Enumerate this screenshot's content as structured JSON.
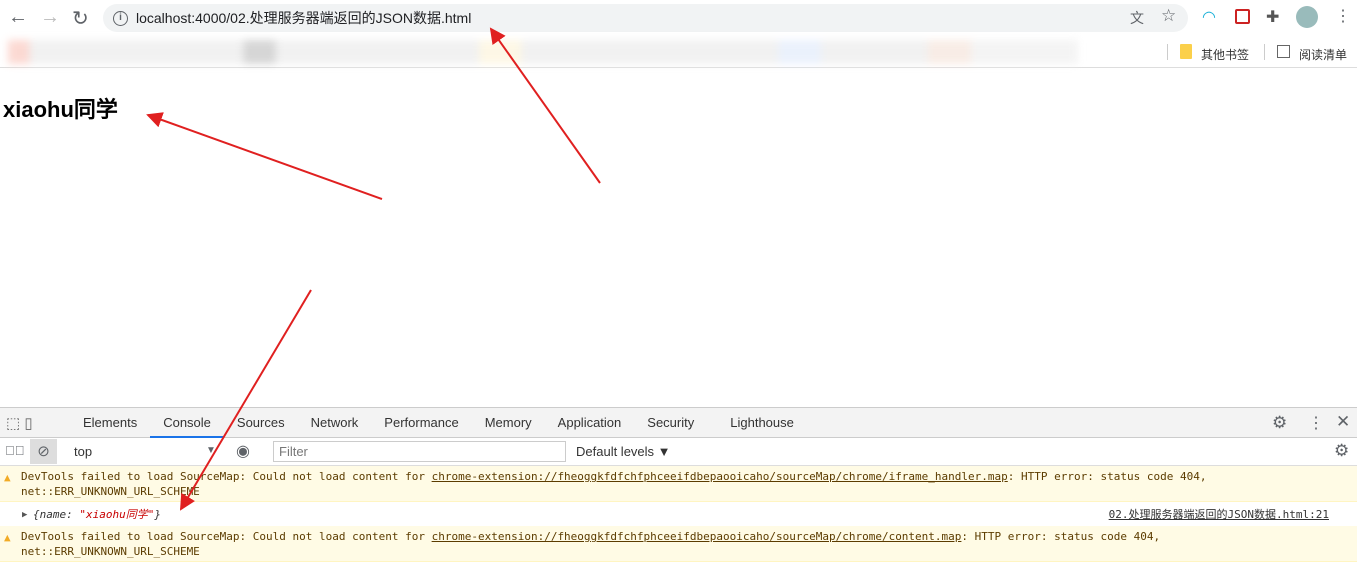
{
  "browser": {
    "url": "localhost:4000/02.处理服务器端返回的JSON数据.html",
    "bookmarks": [
      {
        "label": "其他书签",
        "icon": "folder-icon"
      },
      {
        "label": "阅读清单",
        "icon": "reading-list-icon"
      }
    ]
  },
  "page": {
    "heading": "xiaohu同学"
  },
  "devtools": {
    "tabs": [
      "Elements",
      "Console",
      "Sources",
      "Network",
      "Performance",
      "Memory",
      "Application",
      "Security",
      "Lighthouse"
    ],
    "active_tab": "Console",
    "context": "top",
    "filter_placeholder": "Filter",
    "levels": "Default levels ▼",
    "messages": [
      {
        "prefix": "DevTools failed to load SourceMap: Could not load content for ",
        "link": "chrome-extension://fheoggkfdfchfphceeifdbepaooicaho/sourceMap/chrome/iframe_handler.map",
        "suffix": ": HTTP error: status code 404,",
        "line2": "net::ERR_UNKNOWN_URL_SCHEME"
      },
      {
        "log_open": "{name: ",
        "log_value": "\"xiaohu同学\"",
        "log_close": "}",
        "source": "02.处理服务器端返回的JSON数据.html:21"
      },
      {
        "prefix": "DevTools failed to load SourceMap: Could not load content for ",
        "link": "chrome-extension://fheoggkfdfchfphceeifdbepaooicaho/sourceMap/chrome/content.map",
        "suffix": ": HTTP error: status code 404,",
        "line2": "net::ERR_UNKNOWN_URL_SCHEME"
      }
    ]
  },
  "annotation_color": "#e02020"
}
